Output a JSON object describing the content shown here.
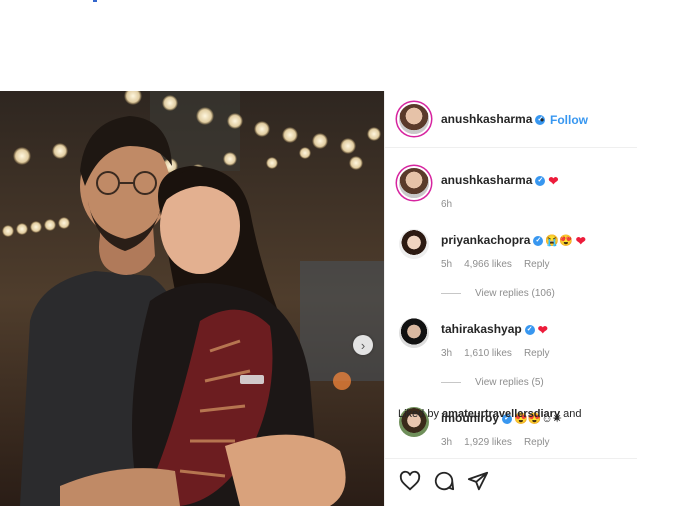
{
  "post": {
    "author": "anushkasharma",
    "follow_label": "Follow",
    "dot": "•",
    "next_icon": "chevron-right-icon"
  },
  "caption": {
    "author": "anushkasharma",
    "time": "6h"
  },
  "comments": [
    {
      "user": "priyankachopra",
      "emojis": "😭😍",
      "time": "5h",
      "likes": "4,966 likes",
      "reply": "Reply",
      "view_replies": "View replies (106)"
    },
    {
      "user": "tahirakashyap",
      "emojis": "",
      "time": "3h",
      "likes": "1,610 likes",
      "reply": "Reply",
      "view_replies": "View replies (5)"
    },
    {
      "user": "imouniroy",
      "emojis": "😍😍☺✴",
      "time": "3h",
      "likes": "1,929 likes",
      "reply": "Reply"
    }
  ],
  "liked_by": {
    "prefix": "Liked by",
    "user": "amateurtravellersdiary",
    "suffix": "and"
  },
  "colors": {
    "verified": "#3897f0",
    "heart": "#ed1c3b",
    "follow": "#3897f0",
    "story_ring": "#d6249f"
  }
}
